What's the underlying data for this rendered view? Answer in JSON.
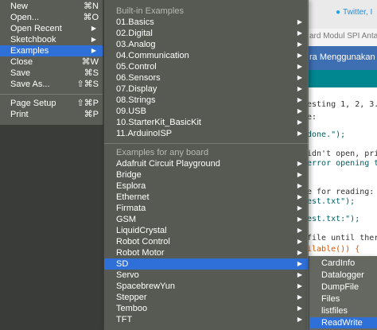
{
  "background": {
    "twitter_text": "Twitter, I",
    "page_line": "ard Modul SPI Antarm",
    "page_banner": "ra Menggunakan M",
    "code": [
      "esting 1, 2, 3.",
      "e:",
      "done.\");",
      "idn't open, print",
      "error opening tes",
      "e for reading:",
      "est.txt\");",
      "est.txt:\");",
      "file until there",
      "ilable()) {",
      ";",
      "",
      "",
      ""
    ]
  },
  "file_menu": {
    "items": [
      {
        "label": "New",
        "shortcut": "⌘N"
      },
      {
        "label": "Open...",
        "shortcut": "⌘O"
      },
      {
        "label": "Open Recent",
        "arrow": "▶"
      },
      {
        "label": "Sketchbook",
        "arrow": "▶"
      },
      {
        "label": "Examples",
        "arrow": "▶"
      },
      {
        "label": "Close",
        "shortcut": "⌘W"
      },
      {
        "label": "Save",
        "shortcut": "⌘S"
      },
      {
        "label": "Save As...",
        "shortcut": "⇧⌘S"
      },
      {
        "label": "Page Setup",
        "shortcut": "⇧⌘P"
      },
      {
        "label": "Print",
        "shortcut": "⌘P"
      }
    ]
  },
  "examples_menu": {
    "builtin_header": "Built-in Examples",
    "builtin": [
      "01.Basics",
      "02.Digital",
      "03.Analog",
      "04.Communication",
      "05.Control",
      "06.Sensors",
      "07.Display",
      "08.Strings",
      "09.USB",
      "10.StarterKit_BasicKit",
      "11.ArduinoISP"
    ],
    "board_header": "Examples for any board",
    "board": [
      "Adafruit Circuit Playground",
      "Bridge",
      "Esplora",
      "Ethernet",
      "Firmata",
      "GSM",
      "LiquidCrystal",
      "Robot Control",
      "Robot Motor",
      "SD",
      "Servo",
      "SpacebrewYun",
      "Stepper",
      "Temboo",
      "TFT"
    ],
    "arrow": "▶"
  },
  "sd_menu": {
    "items": [
      "CardInfo",
      "Datalogger",
      "DumpFile",
      "Files",
      "listfiles",
      "ReadWrite"
    ]
  },
  "colors": {
    "highlight": "#2f6fd8",
    "menu_bg": "#5c6058",
    "editor_header": "#00878f"
  }
}
